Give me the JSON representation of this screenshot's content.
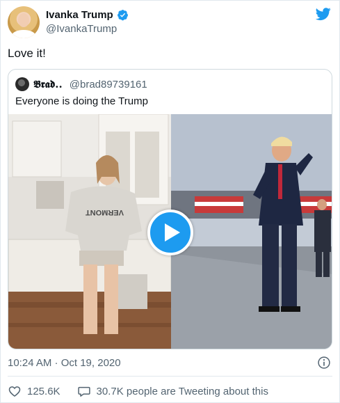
{
  "author": {
    "display_name": "Ivanka Trump",
    "handle": "@IvankaTrump",
    "verified": true
  },
  "tweet": {
    "text": "Love it!"
  },
  "quoted": {
    "display_name": "𝕭𝖗𝖆𝖉..",
    "handle": "@brad89739161",
    "text": "Everyone is doing the Trump"
  },
  "meta": {
    "time": "10:24 AM",
    "separator": "·",
    "date": "Oct 19, 2020",
    "timestamp": "10:24 AM · Oct 19, 2020"
  },
  "actions": {
    "likes": "125.6K",
    "replies_text": "30.7K people are Tweeting about this"
  },
  "icons": {
    "verified": "verified-badge-icon",
    "bird": "twitter-bird-icon",
    "play": "play-icon",
    "info": "info-icon",
    "like": "heart-icon",
    "reply": "speech-bubble-icon"
  },
  "colors": {
    "brand_blue": "#1d9bf0",
    "secondary_text": "#536471",
    "border": "#cfd9de"
  },
  "video_scene": {
    "left_shirt_text": "VERMONT"
  }
}
